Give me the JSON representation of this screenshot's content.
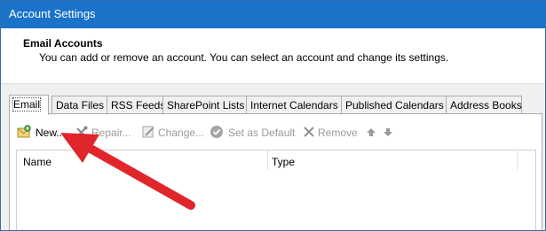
{
  "window": {
    "title": "Account Settings"
  },
  "header": {
    "title": "Email Accounts",
    "description": "You can add or remove an account. You can select an account and change its settings."
  },
  "tabs": [
    {
      "label": "Email",
      "active": true
    },
    {
      "label": "Data Files"
    },
    {
      "label": "RSS Feeds"
    },
    {
      "label": "SharePoint Lists"
    },
    {
      "label": "Internet Calendars"
    },
    {
      "label": "Published Calendars"
    },
    {
      "label": "Address Books"
    }
  ],
  "toolbar": {
    "new": {
      "label": "New...",
      "icon": "new-account-icon",
      "enabled": true
    },
    "repair": {
      "label": "Repair...",
      "icon": "repair-tools-icon",
      "enabled": false
    },
    "change": {
      "label": "Change...",
      "icon": "change-pencil-icon",
      "enabled": false
    },
    "set_default": {
      "label": "Set as Default",
      "icon": "check-circle-icon",
      "enabled": false
    },
    "remove": {
      "label": "Remove",
      "icon": "x-icon",
      "enabled": false
    },
    "move_up": {
      "icon": "arrow-up-icon",
      "enabled": false
    },
    "move_down": {
      "icon": "arrow-down-icon",
      "enabled": false
    }
  },
  "list": {
    "columns": [
      "Name",
      "Type"
    ]
  },
  "annotation": {
    "color": "#e0262b",
    "icon": "red-arrow-annotation"
  }
}
